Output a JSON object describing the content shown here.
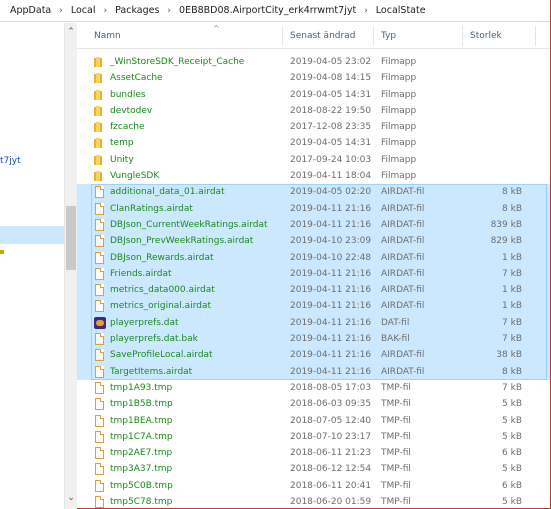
{
  "breadcrumb": [
    "AppData",
    "Local",
    "Packages",
    "0EB8BD08.AirportCity_erk4rrwmt7jyt",
    "LocalState"
  ],
  "nav": {
    "partial_text": "t7jyt"
  },
  "columns": {
    "name": "Namn",
    "date": "Senast ändrad",
    "type": "Typ",
    "size": "Storlek"
  },
  "colors": {
    "selection": "#cce8ff",
    "filename": "#1a8a1a",
    "folder": "#e8b22a"
  },
  "files": [
    {
      "name": "_WinStoreSDK_Receipt_Cache",
      "date": "2019-04-05 23:02",
      "type": "Filmapp",
      "size": "",
      "icon": "folder-icon",
      "selected": false
    },
    {
      "name": "AssetCache",
      "date": "2019-04-08 14:15",
      "type": "Filmapp",
      "size": "",
      "icon": "folder-icon",
      "selected": false
    },
    {
      "name": "bundles",
      "date": "2019-04-05 14:31",
      "type": "Filmapp",
      "size": "",
      "icon": "folder-icon",
      "selected": false
    },
    {
      "name": "devtodev",
      "date": "2018-08-22 19:50",
      "type": "Filmapp",
      "size": "",
      "icon": "folder-icon",
      "selected": false
    },
    {
      "name": "fzcache",
      "date": "2017-12-08 23:35",
      "type": "Filmapp",
      "size": "",
      "icon": "folder-icon",
      "selected": false
    },
    {
      "name": "temp",
      "date": "2019-04-05 14:31",
      "type": "Filmapp",
      "size": "",
      "icon": "folder-icon",
      "selected": false
    },
    {
      "name": "Unity",
      "date": "2017-09-24 10:03",
      "type": "Filmapp",
      "size": "",
      "icon": "folder-icon",
      "selected": false
    },
    {
      "name": "VungleSDK",
      "date": "2019-04-11 18:04",
      "type": "Filmapp",
      "size": "",
      "icon": "folder-icon",
      "selected": false
    },
    {
      "name": "additional_data_01.airdat",
      "date": "2019-04-05 02:20",
      "type": "AIRDAT-fil",
      "size": "8 kB",
      "icon": "file-icon",
      "selected": true
    },
    {
      "name": "ClanRatings.airdat",
      "date": "2019-04-11 21:16",
      "type": "AIRDAT-fil",
      "size": "8 kB",
      "icon": "file-icon",
      "selected": true
    },
    {
      "name": "DBJson_CurrentWeekRatings.airdat",
      "date": "2019-04-11 21:16",
      "type": "AIRDAT-fil",
      "size": "839 kB",
      "icon": "file-icon",
      "selected": true
    },
    {
      "name": "DBJson_PrevWeekRatings.airdat",
      "date": "2019-04-10 23:09",
      "type": "AIRDAT-fil",
      "size": "829 kB",
      "icon": "file-icon",
      "selected": true
    },
    {
      "name": "DBJson_Rewards.airdat",
      "date": "2019-04-10 22:48",
      "type": "AIRDAT-fil",
      "size": "1 kB",
      "icon": "file-icon",
      "selected": true
    },
    {
      "name": "Friends.airdat",
      "date": "2019-04-11 21:16",
      "type": "AIRDAT-fil",
      "size": "7 kB",
      "icon": "file-icon",
      "selected": true
    },
    {
      "name": "metrics_data000.airdat",
      "date": "2019-04-11 21:16",
      "type": "AIRDAT-fil",
      "size": "1 kB",
      "icon": "file-icon",
      "selected": true
    },
    {
      "name": "metrics_original.airdat",
      "date": "2019-04-11 21:16",
      "type": "AIRDAT-fil",
      "size": "1 kB",
      "icon": "file-icon",
      "selected": true
    },
    {
      "name": "playerprefs.dat",
      "date": "2019-04-11 21:16",
      "type": "DAT-fil",
      "size": "7 kB",
      "icon": "app-icon",
      "selected": true
    },
    {
      "name": "playerprefs.dat.bak",
      "date": "2019-04-11 21:16",
      "type": "BAK-fil",
      "size": "7 kB",
      "icon": "file-icon",
      "selected": true
    },
    {
      "name": "SaveProfileLocal.airdat",
      "date": "2019-04-11 21:16",
      "type": "AIRDAT-fil",
      "size": "38 kB",
      "icon": "file-icon",
      "selected": true
    },
    {
      "name": "TargetItems.airdat",
      "date": "2019-04-11 21:16",
      "type": "AIRDAT-fil",
      "size": "8 kB",
      "icon": "file-icon",
      "selected": true
    },
    {
      "name": "tmp1A93.tmp",
      "date": "2018-08-05 17:03",
      "type": "TMP-fil",
      "size": "7 kB",
      "icon": "file-icon",
      "selected": false
    },
    {
      "name": "tmp1B5B.tmp",
      "date": "2018-06-03 09:35",
      "type": "TMP-fil",
      "size": "5 kB",
      "icon": "file-icon",
      "selected": false
    },
    {
      "name": "tmp1BEA.tmp",
      "date": "2018-07-05 12:40",
      "type": "TMP-fil",
      "size": "5 kB",
      "icon": "file-icon",
      "selected": false
    },
    {
      "name": "tmp1C7A.tmp",
      "date": "2018-07-10 23:17",
      "type": "TMP-fil",
      "size": "5 kB",
      "icon": "file-icon",
      "selected": false
    },
    {
      "name": "tmp2AE7.tmp",
      "date": "2018-06-11 21:23",
      "type": "TMP-fil",
      "size": "6 kB",
      "icon": "file-icon",
      "selected": false
    },
    {
      "name": "tmp3A37.tmp",
      "date": "2018-06-12 12:54",
      "type": "TMP-fil",
      "size": "5 kB",
      "icon": "file-icon",
      "selected": false
    },
    {
      "name": "tmp5C0B.tmp",
      "date": "2018-06-11 20:41",
      "type": "TMP-fil",
      "size": "6 kB",
      "icon": "file-icon",
      "selected": false
    },
    {
      "name": "tmp5C78.tmp",
      "date": "2018-06-20 01:59",
      "type": "TMP-fil",
      "size": "5 kB",
      "icon": "file-icon",
      "selected": false
    }
  ]
}
